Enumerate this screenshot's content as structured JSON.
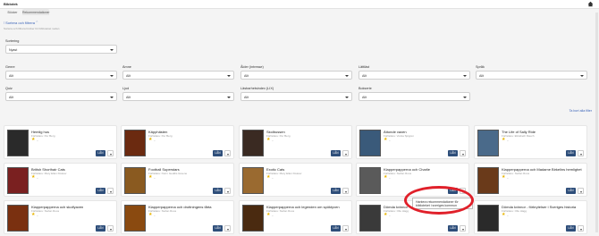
{
  "app": {
    "title": "Biblotek"
  },
  "tabs": [
    {
      "label": "Böcker"
    },
    {
      "label": "Rekommendationer"
    }
  ],
  "sort_toggle": {
    "label": "Sortera och filtrera"
  },
  "hint": "Sortera och filtrera böcker för biblioteket nedan",
  "sortering": {
    "label": "Sortering",
    "value": "Nyast"
  },
  "filters": [
    {
      "label": "Genre",
      "value": "Allt"
    },
    {
      "label": "Ämne",
      "value": "Allt"
    },
    {
      "label": "Ålder (intresse)",
      "value": "Allt"
    },
    {
      "label": "Lättläst",
      "value": "Allt"
    },
    {
      "label": "Språk",
      "value": "Allt"
    },
    {
      "label": "Quiz",
      "value": "Allt"
    },
    {
      "label": "Ljud",
      "value": "Allt"
    },
    {
      "label": "Läsbarhetsindex (LIX)",
      "value": "Allt"
    },
    {
      "label": "Bokserie",
      "value": "Allt"
    }
  ],
  "clear_filters": "Ta bort alla filter",
  "card_labels": {
    "lan": "LÅN",
    "rating_dash": "–"
  },
  "books": [
    {
      "title": "Hemlig hus",
      "author": "Författare: Per Berg",
      "cover_color": "#2a2a2a"
    },
    {
      "title": "Käpphästen",
      "author": "Författare: Per Berg",
      "cover_color": "#6b2a10"
    },
    {
      "title": "Skolbussen",
      "author": "Författare: Per Berg",
      "cover_color": "#3a2a22"
    },
    {
      "title": "Ättonde vaxen",
      "author": "Författare: Vovka Sjögren",
      "cover_color": "#3a5a7a"
    },
    {
      "title": "The Life of Sally Ride",
      "author": "Författare: Elizabeth Rauch",
      "cover_color": "#4a6a8a"
    },
    {
      "title": "British Shorthair Cats",
      "author": "Författare: Mary Ellen Klukow",
      "cover_color": "#7a2020"
    },
    {
      "title": "Football Superstars",
      "author": "Författare: Norm Geddis Greene",
      "cover_color": "#8a5a20"
    },
    {
      "title": "Exotic Cats",
      "author": "Författare: Mary Ellen Klukow",
      "cover_color": "#9a6a30"
    },
    {
      "title": "Klapperpapperna och Charlie",
      "author": "Författare: Stefan Roos",
      "cover_color": "#5a5a5a"
    },
    {
      "title": "Klapperpapperna och Madame Birkelins hemlighet",
      "author": "Författare: Stefan Roos",
      "cover_color": "#6a3a1a"
    },
    {
      "title": "Klapperpapperna och skolfyaven",
      "author": "Författare: Stefan Roos",
      "cover_color": "#7a3010"
    },
    {
      "title": "Klapperpapperna och drottningens tårta",
      "author": "Författare: Stefan Roos",
      "cover_color": "#8a4a10"
    },
    {
      "title": "Klapperpapperna och legenden om spöktyven",
      "author": "Författare: Stefan Roos",
      "cover_color": "#4a2a10"
    },
    {
      "title": "Dömda kvinnor",
      "author": "Författare: Olle Hägg",
      "cover_color": "#3a3a3a"
    },
    {
      "title": "Dömda kvinnor - förbrytelser i Sveriges historia",
      "author": "Författare: Olle Hägg",
      "cover_color": "#2a2a2a"
    }
  ],
  "tooltip": "Hantera rekommendationer för biblioteket i sveriges kommun",
  "colors": {
    "accent": "#3a63b8",
    "lan_button": "#2e4e7a",
    "highlight_circle": "#e0202a",
    "star": "#e8b400"
  }
}
